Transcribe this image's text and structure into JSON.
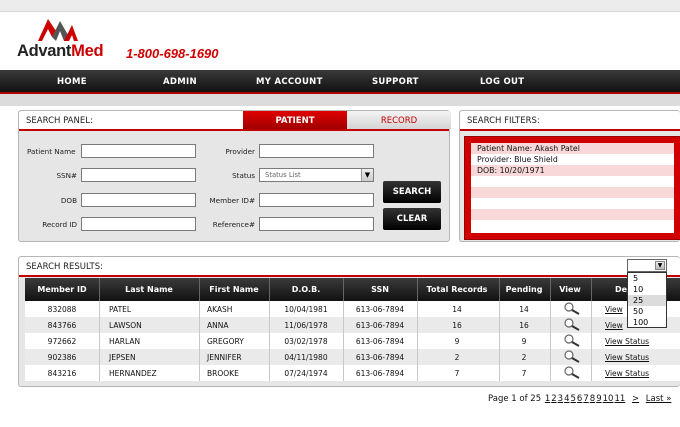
{
  "brand": {
    "name_part1": "Advant",
    "name_part2": "Med",
    "phone": "1-800-698-1690"
  },
  "nav": [
    "HOME",
    "ADMIN",
    "MY ACCOUNT",
    "SUPPORT",
    "LOG OUT"
  ],
  "search_panel": {
    "title": "SEARCH PANEL:",
    "tabs": [
      "PATIENT",
      "RECORD"
    ],
    "fields": {
      "patient_name": "Patient Name",
      "ssn": "SSN#",
      "dob": "DOB",
      "record_id": "Record ID",
      "provider": "Provider",
      "status": "Status",
      "member_id": "Member ID#",
      "reference": "Reference#"
    },
    "status_placeholder": "Status List",
    "search_button": "SEARCH",
    "clear_button": "CLEAR"
  },
  "filters": {
    "title": "SEARCH FILTERS:",
    "lines": [
      "Patient Name:  Akash Patel",
      "Provider: Blue Shield",
      "DOB: 10/20/1971"
    ]
  },
  "results": {
    "title": "SEARCH RESULTS:",
    "columns": [
      "Member ID",
      "Last Name",
      "First Name",
      "D.O.B.",
      "SSN",
      "Total Records",
      "Pending",
      "View",
      "Details"
    ],
    "column_visible_label": "De",
    "rows": [
      {
        "member_id": "832088",
        "last": "PATEL",
        "first": "AKASH",
        "dob": "10/04/1981",
        "ssn": "613-06-7894",
        "total": "14",
        "pending": "14",
        "details": "View"
      },
      {
        "member_id": "843766",
        "last": "LAWSON",
        "first": "ANNA",
        "dob": "11/06/1978",
        "ssn": "613-06-7894",
        "total": "16",
        "pending": "16",
        "details": "View"
      },
      {
        "member_id": "972662",
        "last": "HARLAN",
        "first": "GREGORY",
        "dob": "03/02/1978",
        "ssn": "613-06-7894",
        "total": "9",
        "pending": "9",
        "details": "View Status"
      },
      {
        "member_id": "902386",
        "last": "JEPSEN",
        "first": "JENNIFER",
        "dob": "04/11/1980",
        "ssn": "613-06-7894",
        "total": "2",
        "pending": "2",
        "details": "View Status"
      },
      {
        "member_id": "843216",
        "last": "HERNANDEZ",
        "first": "BROOKE",
        "dob": "07/24/1974",
        "ssn": "613-06-7894",
        "total": "7",
        "pending": "7",
        "details": "View Status"
      }
    ],
    "page_size_options": [
      "5",
      "10",
      "25",
      "50",
      "100"
    ],
    "page_size_selected": "25"
  },
  "pager": {
    "prefix": "Page 1 of 25",
    "pages": [
      "1",
      "2",
      "3",
      "4",
      "5",
      "6",
      "7",
      "8",
      "9",
      "10",
      "11"
    ],
    "next": ">",
    "last": "Last »"
  },
  "colors": {
    "brand_red": "#cc0000",
    "nav_dark": "#111111"
  },
  "icons": {
    "view": "magnifier-icon",
    "dropdown": "chevron-down-icon"
  }
}
